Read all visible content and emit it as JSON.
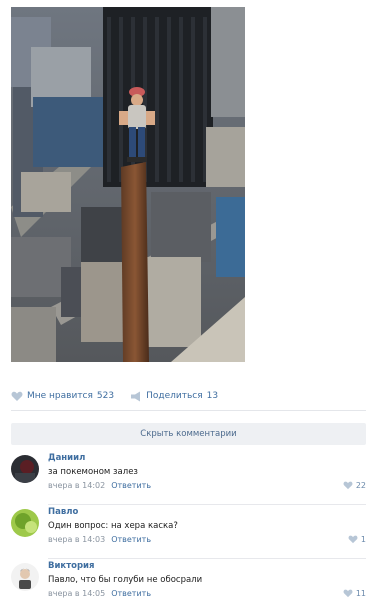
{
  "post": {
    "photo_icon": "city-skyscraper-worker-photo",
    "actions": {
      "like_label": "Мне нравится",
      "like_count": "523",
      "share_label": "Поделиться",
      "share_count": "13"
    }
  },
  "comments": {
    "hide_label": "Скрыть комментарии",
    "items": [
      {
        "author": "Даниил",
        "text": "за покемоном залез",
        "time": "вчера в 14:02",
        "reply_label": "Ответить",
        "likes": "22",
        "avatar_icon": "user-avatar-dark"
      },
      {
        "author": "Павло",
        "text": "Один вопрос: на хера каска?",
        "time": "вчера в 14:03",
        "reply_label": "Ответить",
        "likes": "1",
        "avatar_icon": "user-avatar-green"
      },
      {
        "author": "Виктория",
        "text": "Павло, что бы голуби не обосрали",
        "time": "вчера в 14:05",
        "reply_label": "Ответить",
        "likes": "11",
        "avatar_icon": "user-avatar-light"
      }
    ]
  },
  "colors": {
    "link": "#3f6ea0",
    "meta": "#8a94a0",
    "button_bg": "#eef0f3"
  }
}
